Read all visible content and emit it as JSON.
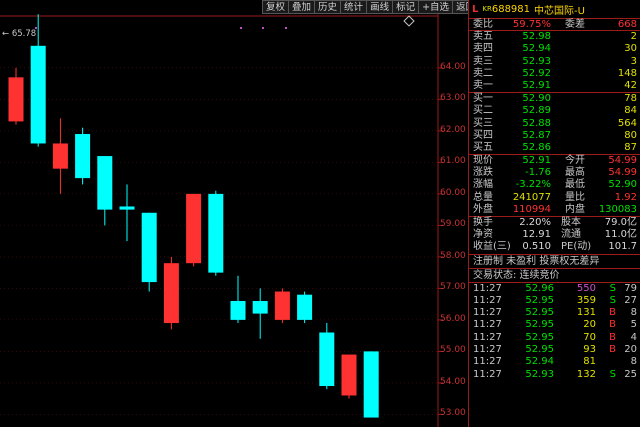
{
  "toolbar": {
    "buttons": [
      "复权",
      "叠加",
      "历史",
      "统计",
      "画线",
      "标记",
      "+自选",
      "返回"
    ]
  },
  "chart": {
    "high_label": "65.78",
    "y_ticks": [
      "64.00",
      "63.00",
      "62.00",
      "61.00",
      "60.00",
      "59.00",
      "58.00",
      "57.00",
      "56.00",
      "55.00",
      "54.00",
      "53.00"
    ],
    "up_color": "#ff3232",
    "down_color": "#00ffff"
  },
  "chart_data": {
    "type": "candlestick",
    "y_range": [
      52.6,
      65.9
    ],
    "candles": [
      {
        "open": 62.3,
        "close": 63.7,
        "high": 64.0,
        "low": 62.2
      },
      {
        "open": 64.7,
        "close": 61.6,
        "high": 65.7,
        "low": 61.5
      },
      {
        "open": 60.8,
        "close": 61.6,
        "high": 62.4,
        "low": 60.0
      },
      {
        "open": 61.9,
        "close": 60.5,
        "high": 62.1,
        "low": 60.3
      },
      {
        "open": 61.2,
        "close": 59.5,
        "high": 61.2,
        "low": 59.0
      },
      {
        "open": 59.6,
        "close": 59.5,
        "high": 60.3,
        "low": 58.5
      },
      {
        "open": 59.4,
        "close": 57.2,
        "high": 59.4,
        "low": 56.9
      },
      {
        "open": 55.9,
        "close": 57.8,
        "high": 58.0,
        "low": 55.7
      },
      {
        "open": 57.8,
        "close": 60.0,
        "high": 60.0,
        "low": 57.7
      },
      {
        "open": 60.0,
        "close": 57.5,
        "high": 60.1,
        "low": 57.4
      },
      {
        "open": 56.6,
        "close": 56.0,
        "high": 57.4,
        "low": 55.9
      },
      {
        "open": 56.6,
        "close": 56.2,
        "high": 57.0,
        "low": 55.4
      },
      {
        "open": 56.0,
        "close": 56.9,
        "high": 57.0,
        "low": 55.9
      },
      {
        "open": 56.8,
        "close": 56.0,
        "high": 56.9,
        "low": 55.9
      },
      {
        "open": 55.6,
        "close": 53.9,
        "high": 55.9,
        "low": 53.8
      },
      {
        "open": 53.6,
        "close": 54.9,
        "high": 54.9,
        "low": 53.5
      },
      {
        "open": 55.0,
        "close": 52.9,
        "high": 55.0,
        "low": 52.9
      }
    ]
  },
  "stock": {
    "l_mark": "L",
    "kr": "KR",
    "code": "688981",
    "name": "中芯国际-U"
  },
  "weibi": {
    "label1": "委比",
    "value1": "59.75%",
    "label2": "委差",
    "value2": "668"
  },
  "asks": [
    {
      "label": "卖五",
      "price": "52.98",
      "qty": "2"
    },
    {
      "label": "卖四",
      "price": "52.94",
      "qty": "30"
    },
    {
      "label": "卖三",
      "price": "52.93",
      "qty": "3"
    },
    {
      "label": "卖二",
      "price": "52.92",
      "qty": "148"
    },
    {
      "label": "卖一",
      "price": "52.91",
      "qty": "42"
    }
  ],
  "bids": [
    {
      "label": "买一",
      "price": "52.90",
      "qty": "78"
    },
    {
      "label": "买二",
      "price": "52.89",
      "qty": "84"
    },
    {
      "label": "买三",
      "price": "52.88",
      "qty": "564"
    },
    {
      "label": "买四",
      "price": "52.87",
      "qty": "80"
    },
    {
      "label": "买五",
      "price": "52.86",
      "qty": "87"
    }
  ],
  "quote": [
    {
      "l1": "现价",
      "v1": "52.91",
      "c1": "green",
      "l2": "今开",
      "v2": "54.99",
      "c2": "red"
    },
    {
      "l1": "涨跌",
      "v1": "-1.76",
      "c1": "green",
      "l2": "最高",
      "v2": "54.99",
      "c2": "red"
    },
    {
      "l1": "涨幅",
      "v1": "-3.22%",
      "c1": "green",
      "l2": "最低",
      "v2": "52.90",
      "c2": "green"
    },
    {
      "l1": "总量",
      "v1": "241077",
      "c1": "yellow",
      "l2": "量比",
      "v2": "1.92",
      "c2": "red"
    },
    {
      "l1": "外盘",
      "v1": "110994",
      "c1": "red",
      "l2": "内盘",
      "v2": "130083",
      "c2": "green"
    }
  ],
  "stats": [
    {
      "l1": "换手",
      "v1": "2.20%",
      "l2": "股本",
      "v2": "79.0亿"
    },
    {
      "l1": "净资",
      "v1": "12.91",
      "l2": "流通",
      "v2": "11.0亿"
    },
    {
      "l1": "收益(三)",
      "v1": "0.510",
      "l2": "PE(动)",
      "v2": "101.7"
    }
  ],
  "notes": {
    "line1": "注册制 未盈利 投票权无差异",
    "line2": "交易状态: 连续竞价"
  },
  "ticks": [
    {
      "time": "11:27",
      "price": "52.96",
      "vol": "550",
      "bs": "S",
      "n": "79",
      "vol_color": "purple",
      "bs_color": "green"
    },
    {
      "time": "11:27",
      "price": "52.95",
      "vol": "359",
      "bs": "S",
      "n": "27",
      "vol_color": "yellow",
      "bs_color": "green"
    },
    {
      "time": "11:27",
      "price": "52.95",
      "vol": "131",
      "bs": "B",
      "n": "8",
      "vol_color": "yellow",
      "bs_color": "red"
    },
    {
      "time": "11:27",
      "price": "52.95",
      "vol": "20",
      "bs": "B",
      "n": "5",
      "vol_color": "yellow",
      "bs_color": "red"
    },
    {
      "time": "11:27",
      "price": "52.95",
      "vol": "70",
      "bs": "B",
      "n": "4",
      "vol_color": "yellow",
      "bs_color": "red"
    },
    {
      "time": "11:27",
      "price": "52.95",
      "vol": "93",
      "bs": "B",
      "n": "20",
      "vol_color": "yellow",
      "bs_color": "red"
    },
    {
      "time": "11:27",
      "price": "52.94",
      "vol": "81",
      "bs": "",
      "n": "8",
      "vol_color": "yellow",
      "bs_color": "red"
    },
    {
      "time": "11:27",
      "price": "52.93",
      "vol": "132",
      "bs": "S",
      "n": "25",
      "vol_color": "yellow",
      "bs_color": "green"
    }
  ]
}
